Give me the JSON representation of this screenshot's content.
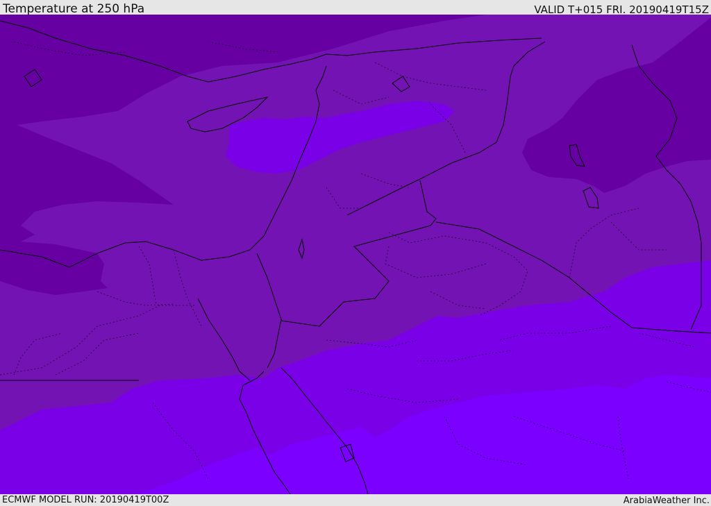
{
  "header": {
    "title": "Temperature at 250 hPa",
    "valid_time": "VALID T+015 FRI. 20190419T15Z"
  },
  "footer": {
    "model_run": "ECMWF MODEL RUN: 20190419T00Z",
    "credit": "ArabiaWeather Inc."
  },
  "map": {
    "variable": "Temperature",
    "level": "250 hPa",
    "shading_colors": {
      "coldest_deep": "#6600a3",
      "cold": "#7413b3",
      "mid": "#7c00dc",
      "warm": "#7a00e8",
      "warmest": "#7b00ff"
    },
    "border_color": "#000000"
  }
}
